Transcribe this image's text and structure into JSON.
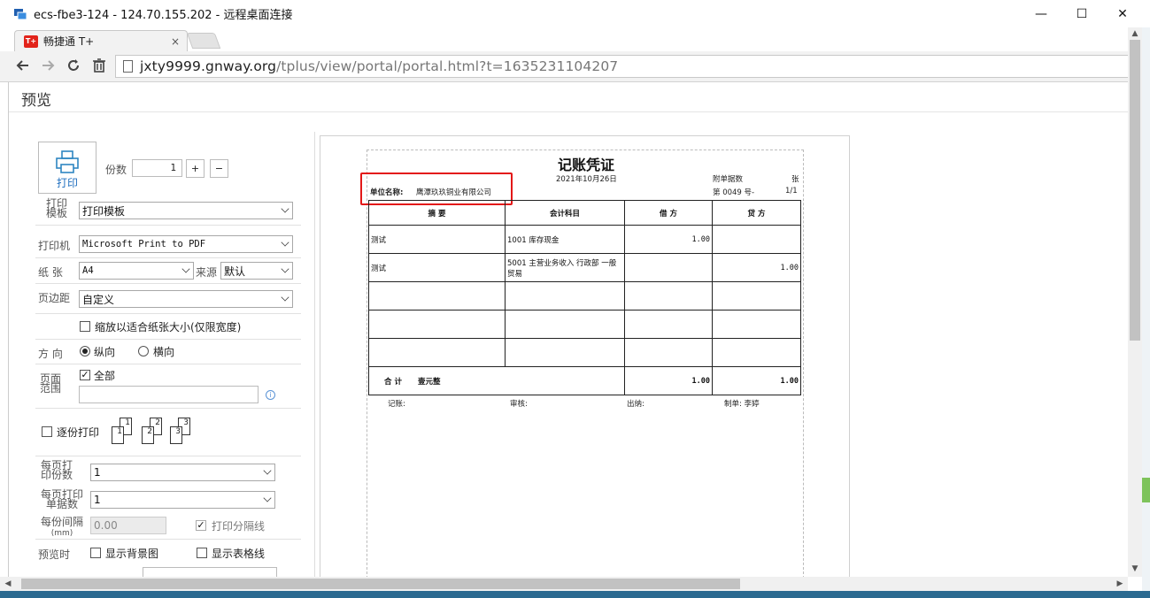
{
  "window": {
    "title": "ecs-fbe3-124 - 124.70.155.202 - 远程桌面连接",
    "minimize": "—",
    "maximize": "☐",
    "close": "✕"
  },
  "browser": {
    "tab_label": "畅捷通 T+",
    "tab_icon_text": "T+",
    "tab_close": "×",
    "url_host": "jxty9999.gnway.org",
    "url_path": "/tplus/view/portal/portal.html?t=1635231104207"
  },
  "page": {
    "title": "预览"
  },
  "panel": {
    "print_label": "打印",
    "copies_label": "份数",
    "copies_value": "1",
    "plus": "+",
    "minus": "−",
    "template_label_1": "打印",
    "template_label_2": "模板",
    "template_value": "打印模板",
    "printer_label": "打印机",
    "printer_value": "Microsoft Print to PDF",
    "paper_label": "纸  张",
    "paper_value": "A4",
    "source_label": "来源",
    "source_value": "默认",
    "margin_label": "页边距",
    "margin_value": "自定义",
    "fit_label": "缩放以适合纸张大小(仅限宽度)",
    "orient_label": "方  向",
    "portrait_label": "纵向",
    "landscape_label": "横向",
    "range_label_1": "页面",
    "range_label_2": "范围",
    "all_label": "全部",
    "collate_label": "逐份打印",
    "per_page_copies_label_1": "每页打",
    "per_page_copies_label_2": "印份数",
    "per_page_copies_value": "1",
    "per_page_docs_label_1": "每页打印",
    "per_page_docs_label_2": "单据数",
    "per_page_docs_value": "1",
    "gap_label_1": "每份间隔",
    "gap_label_2": "(mm)",
    "gap_value": "0.00",
    "separator_label": "打印分隔线",
    "preview_label": "预览时",
    "bg_label": "显示背景图",
    "grid_label": "显示表格线"
  },
  "voucher": {
    "title": "记账凭证",
    "date": "2021年10月26日",
    "attach_label": "附单据数",
    "attach_unit": "张",
    "company_label": "单位名称:",
    "company_value": "鹰潭玖玖铜业有限公司",
    "number_text": "第  0049  号-",
    "page_text": "1/1",
    "headers": [
      "摘  要",
      "会计科目",
      "借  方",
      "贷  方"
    ],
    "rows": [
      {
        "summary": "测试",
        "account": "1001 库存现金",
        "debit": "1.00",
        "credit": ""
      },
      {
        "summary": "测试",
        "account": "5001 主营业务收入 行政部 一般贸易",
        "debit": "",
        "credit": "1.00"
      },
      {
        "summary": "",
        "account": "",
        "debit": "",
        "credit": ""
      },
      {
        "summary": "",
        "account": "",
        "debit": "",
        "credit": ""
      },
      {
        "summary": "",
        "account": "",
        "debit": "",
        "credit": ""
      }
    ],
    "total_label": "合  计",
    "total_words": "壹元整",
    "total_debit": "1.00",
    "total_credit": "1.00",
    "footer_book": "记账:",
    "footer_review": "审核:",
    "footer_cashier": "出纳:",
    "footer_maker": "制单: 李婷"
  }
}
